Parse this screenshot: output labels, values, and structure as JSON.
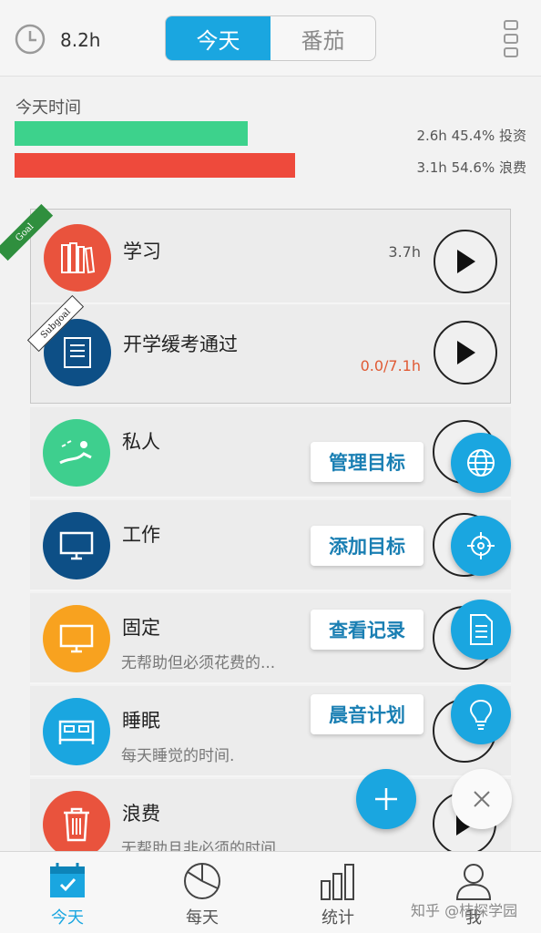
{
  "header": {
    "clock_icon": "clock-icon",
    "total_hours": "8.2h",
    "tabs": [
      {
        "label": "今天",
        "active": true
      },
      {
        "label": "番茄",
        "active": false
      }
    ],
    "menu_icon": "more-vertical-icon"
  },
  "summary": {
    "label": "今天时间",
    "invest": {
      "text": "2.6h 45.4% 投资",
      "color": "#3dd28c",
      "percent": 45.4
    },
    "waste": {
      "text": "3.1h 54.6% 浪费",
      "color": "#ee4a3c",
      "percent": 54.6
    }
  },
  "goals": [
    {
      "ribbon": "Goal",
      "name": "学习",
      "amount": "3.7h",
      "icon": "books-icon",
      "color": "#e9533d"
    },
    {
      "ribbon": "Subgoal",
      "name": "开学缓考通过",
      "amount": "0.0/7.1h",
      "icon": "notebook-icon",
      "color": "#0d4f86"
    }
  ],
  "categories": [
    {
      "name": "私人",
      "desc": "",
      "icon": "relax-icon",
      "color": "#3ecf8e"
    },
    {
      "name": "工作",
      "desc": "",
      "icon": "monitor-icon",
      "color": "#0d4f86"
    },
    {
      "name": "固定",
      "desc": "无帮助但必须花费的...",
      "icon": "monitor-icon",
      "color": "#f8a21f"
    },
    {
      "name": "睡眠",
      "desc": "每天睡觉的时间.",
      "icon": "bed-icon",
      "color": "#1aa6e0"
    },
    {
      "name": "浪费",
      "desc": "无帮助且非必须的时间",
      "icon": "trash-icon",
      "color": "#e9533d"
    }
  ],
  "fab_menu": [
    {
      "label": "管理目标",
      "icon": "globe-icon"
    },
    {
      "label": "添加目标",
      "icon": "target-icon"
    },
    {
      "label": "查看记录",
      "icon": "document-icon"
    },
    {
      "label": "晨音计划",
      "icon": "lightbulb-icon"
    }
  ],
  "bottom_nav": [
    {
      "label": "今天",
      "icon": "calendar-check-icon",
      "active": true
    },
    {
      "label": "每天",
      "icon": "pie-chart-icon",
      "active": false
    },
    {
      "label": "统计",
      "icon": "bar-chart-icon",
      "active": false
    },
    {
      "label": "我",
      "icon": "user-icon",
      "active": false
    }
  ],
  "watermark": "知乎 @桔探学园"
}
